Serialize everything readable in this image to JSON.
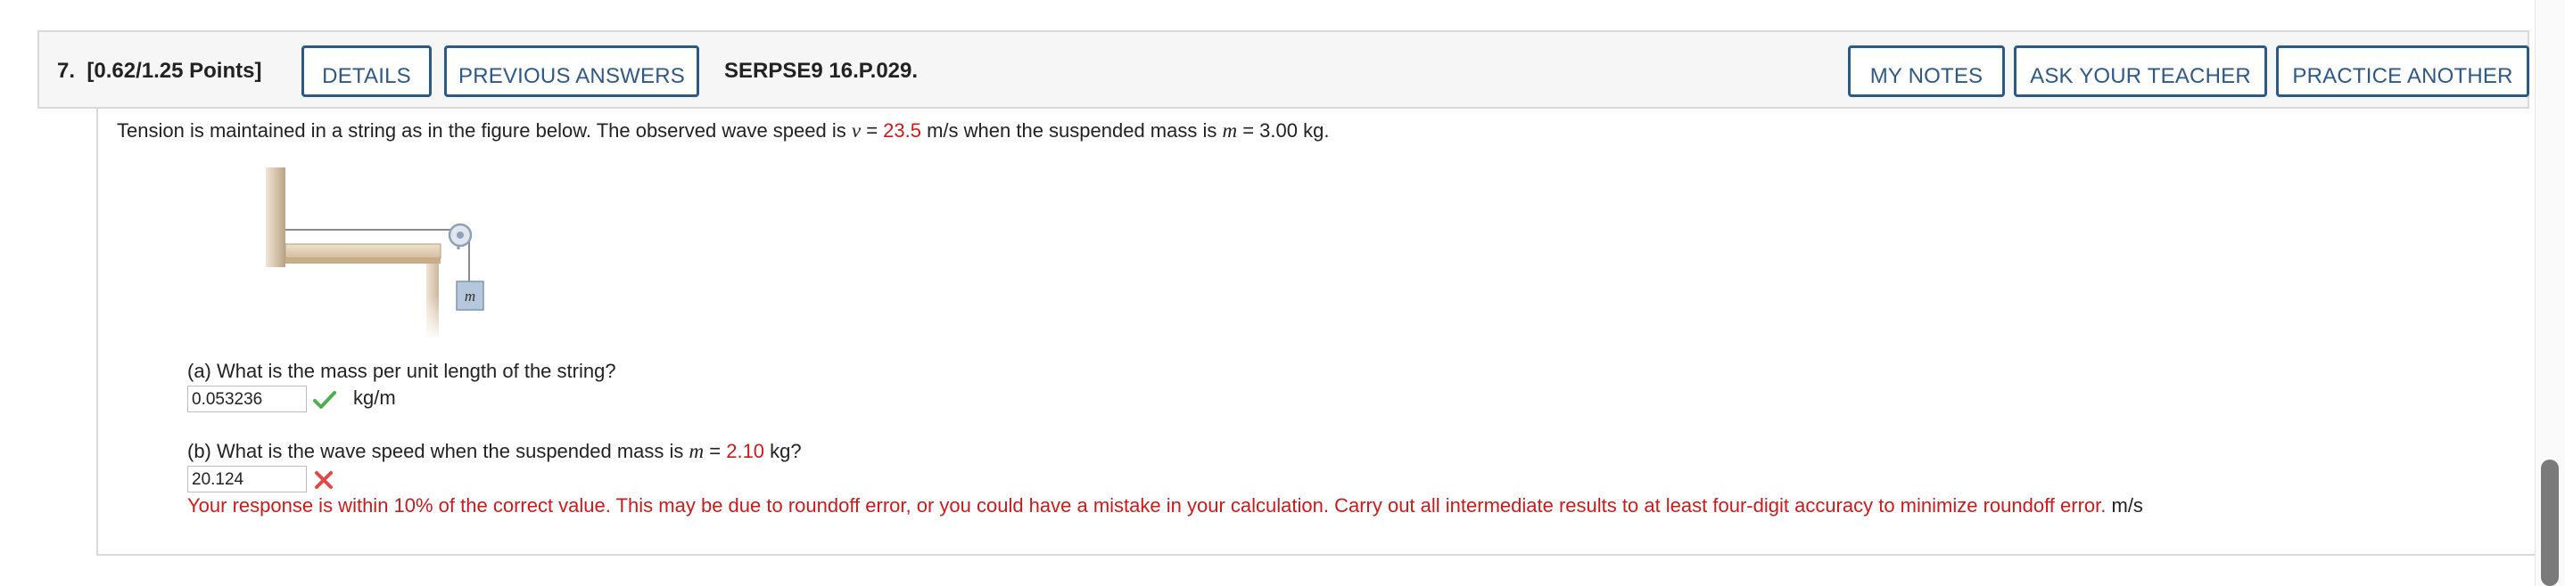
{
  "header": {
    "question_number": "7.",
    "points": "[0.62/1.25 Points]",
    "details_label": "DETAILS",
    "previous_answers_label": "PREVIOUS ANSWERS",
    "question_id": "SERPSE9 16.P.029.",
    "my_notes_label": "MY NOTES",
    "ask_teacher_label": "ASK YOUR TEACHER",
    "practice_another_label": "PRACTICE ANOTHER"
  },
  "problem": {
    "intro_1": "Tension is maintained in a string as in the figure below. The observed wave speed is ",
    "var_v": "v",
    "eq_1": " = ",
    "speed_value": "23.5",
    "intro_2": " m/s when the suspended mass is ",
    "var_m": "m",
    "eq_2": " = 3.00 kg.",
    "figure_mass_label": "m"
  },
  "part_a": {
    "question": "(a) What is the mass per unit length of the string?",
    "answer": "0.053236",
    "unit": "kg/m",
    "status_icon": "check-icon"
  },
  "part_b": {
    "question_1": "(b) What is the wave speed when the suspended mass is ",
    "var_m": "m",
    "question_2": " = ",
    "mass_value": "2.10",
    "question_3": " kg?",
    "answer": "20.124",
    "status_icon": "x-icon",
    "feedback": "Your response is within 10% of the correct value. This may be due to roundoff error, or you could have a mistake in your calculation. Carry out all intermediate results to at least four-digit accuracy to minimize roundoff error.",
    "unit": " m/s"
  },
  "colors": {
    "accent": "#2d5986",
    "error": "#cc1a1a",
    "correct": "#4caf50"
  }
}
